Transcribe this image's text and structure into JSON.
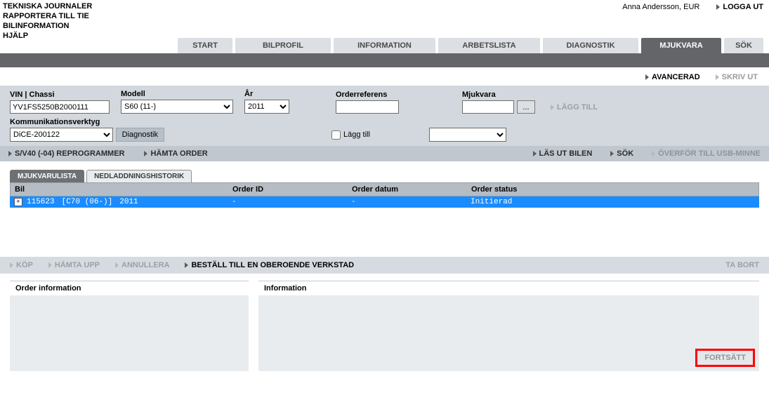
{
  "header": {
    "top_links": [
      "TEKNISKA JOURNALER",
      "RAPPORTERA TILL TIE",
      "BILINFORMATION",
      "HJÄLP"
    ],
    "user": "Anna Andersson, EUR",
    "logout": "LOGGA UT"
  },
  "nav": {
    "tabs": [
      "START",
      "BILPROFIL",
      "INFORMATION",
      "ARBETSLISTA",
      "DIAGNOSTIK",
      "MJUKVARA",
      "SÖK"
    ],
    "active_index": 5
  },
  "toolbar_top": {
    "advanced": "AVANCERAD",
    "print": "SKRIV UT"
  },
  "filter": {
    "vin_label": "VIN | Chassi",
    "vin_value": "YV1FS5250B2000111",
    "model_label": "Modell",
    "model_value": "S60 (11-)",
    "year_label": "År",
    "year_value": "2011",
    "orderref_label": "Orderreferens",
    "orderref_value": "",
    "software_label": "Mjukvara",
    "software_value": "",
    "dots": "...",
    "add_label": "LÄGG TILL",
    "comm_label": "Kommunikationsverktyg",
    "comm_value": "DiCE-200122",
    "diag_btn": "Diagnostik",
    "addchk_label": "Lägg till"
  },
  "action_bar": {
    "left": [
      "S/V40 (-04) REPROGRAMMER",
      "HÄMTA ORDER"
    ],
    "right": [
      "LÄS UT BILEN",
      "SÖK",
      "ÖVERFÖR TILL USB-MINNE"
    ]
  },
  "subtabs": {
    "items": [
      "MJUKVARULISTA",
      "NEDLADDNINGSHISTORIK"
    ],
    "active_index": 0
  },
  "table": {
    "headers": [
      "Bil",
      "Order ID",
      "Order datum",
      "Order status"
    ],
    "row": {
      "id": "115623",
      "model": "[C70 (06-)]",
      "year": "2011",
      "order_id": "-",
      "order_date": "-",
      "status": "Initierad"
    }
  },
  "lower_bar": {
    "left": [
      {
        "label": "KÖP",
        "disabled": true
      },
      {
        "label": "HÄMTA UPP",
        "disabled": true
      },
      {
        "label": "ANNULLERA",
        "disabled": true
      },
      {
        "label": "BESTÄLL TILL EN OBEROENDE VERKSTAD",
        "disabled": false
      }
    ],
    "right": {
      "label": "TA BORT",
      "disabled": true
    }
  },
  "panels": {
    "order_info_title": "Order information",
    "info_title": "Information",
    "continue": "FORTSÄTT"
  }
}
